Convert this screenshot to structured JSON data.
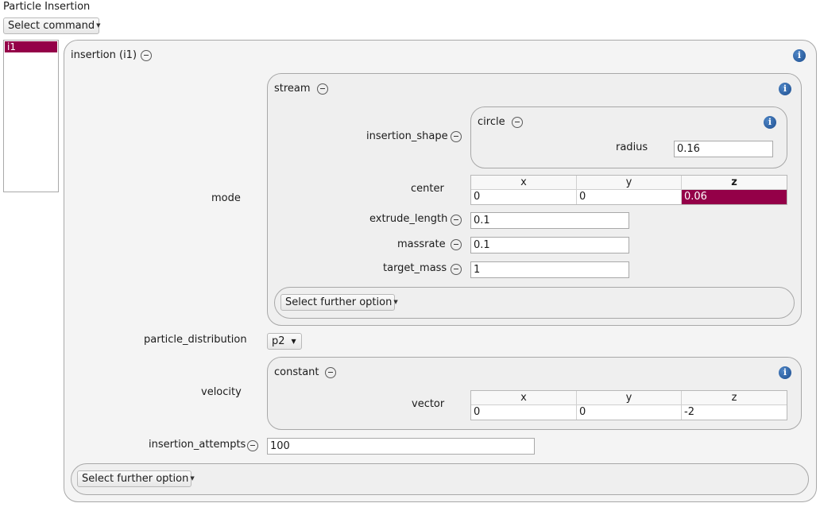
{
  "header": {
    "title": "Particle Insertion",
    "select_command": "Select command"
  },
  "sidebar": {
    "items": [
      {
        "label": "i1",
        "selected": true
      }
    ]
  },
  "insertion": {
    "title": "insertion (i1)",
    "mode_label": "mode",
    "stream": {
      "title": "stream",
      "insertion_shape_label": "insertion_shape",
      "circle": {
        "title": "circle",
        "radius_label": "radius",
        "radius_value": "0.16"
      },
      "center": {
        "label": "center",
        "headers": [
          "x",
          "y",
          "z"
        ],
        "values": [
          "0",
          "0",
          "0.06"
        ]
      },
      "extrude_length": {
        "label": "extrude_length",
        "value": "0.1"
      },
      "massrate": {
        "label": "massrate",
        "value": "0.1"
      },
      "target_mass": {
        "label": "target_mass",
        "value": "1"
      },
      "further_option": "Select further option"
    },
    "particle_distribution": {
      "label": "particle_distribution",
      "value": "p2"
    },
    "velocity": {
      "label": "velocity",
      "constant": {
        "title": "constant",
        "vector_label": "vector",
        "headers": [
          "x",
          "y",
          "z"
        ],
        "values": [
          "0",
          "0",
          "-2"
        ]
      }
    },
    "insertion_attempts": {
      "label": "insertion_attempts",
      "value": "100"
    },
    "further_option": "Select further option"
  },
  "icons": {
    "info": "info-icon",
    "collapse": "minus-circle-icon",
    "dropdown": "chevron-down-icon"
  },
  "colors": {
    "selection": "#940048",
    "info": "#1d4e8f",
    "panel": "#efefef"
  }
}
